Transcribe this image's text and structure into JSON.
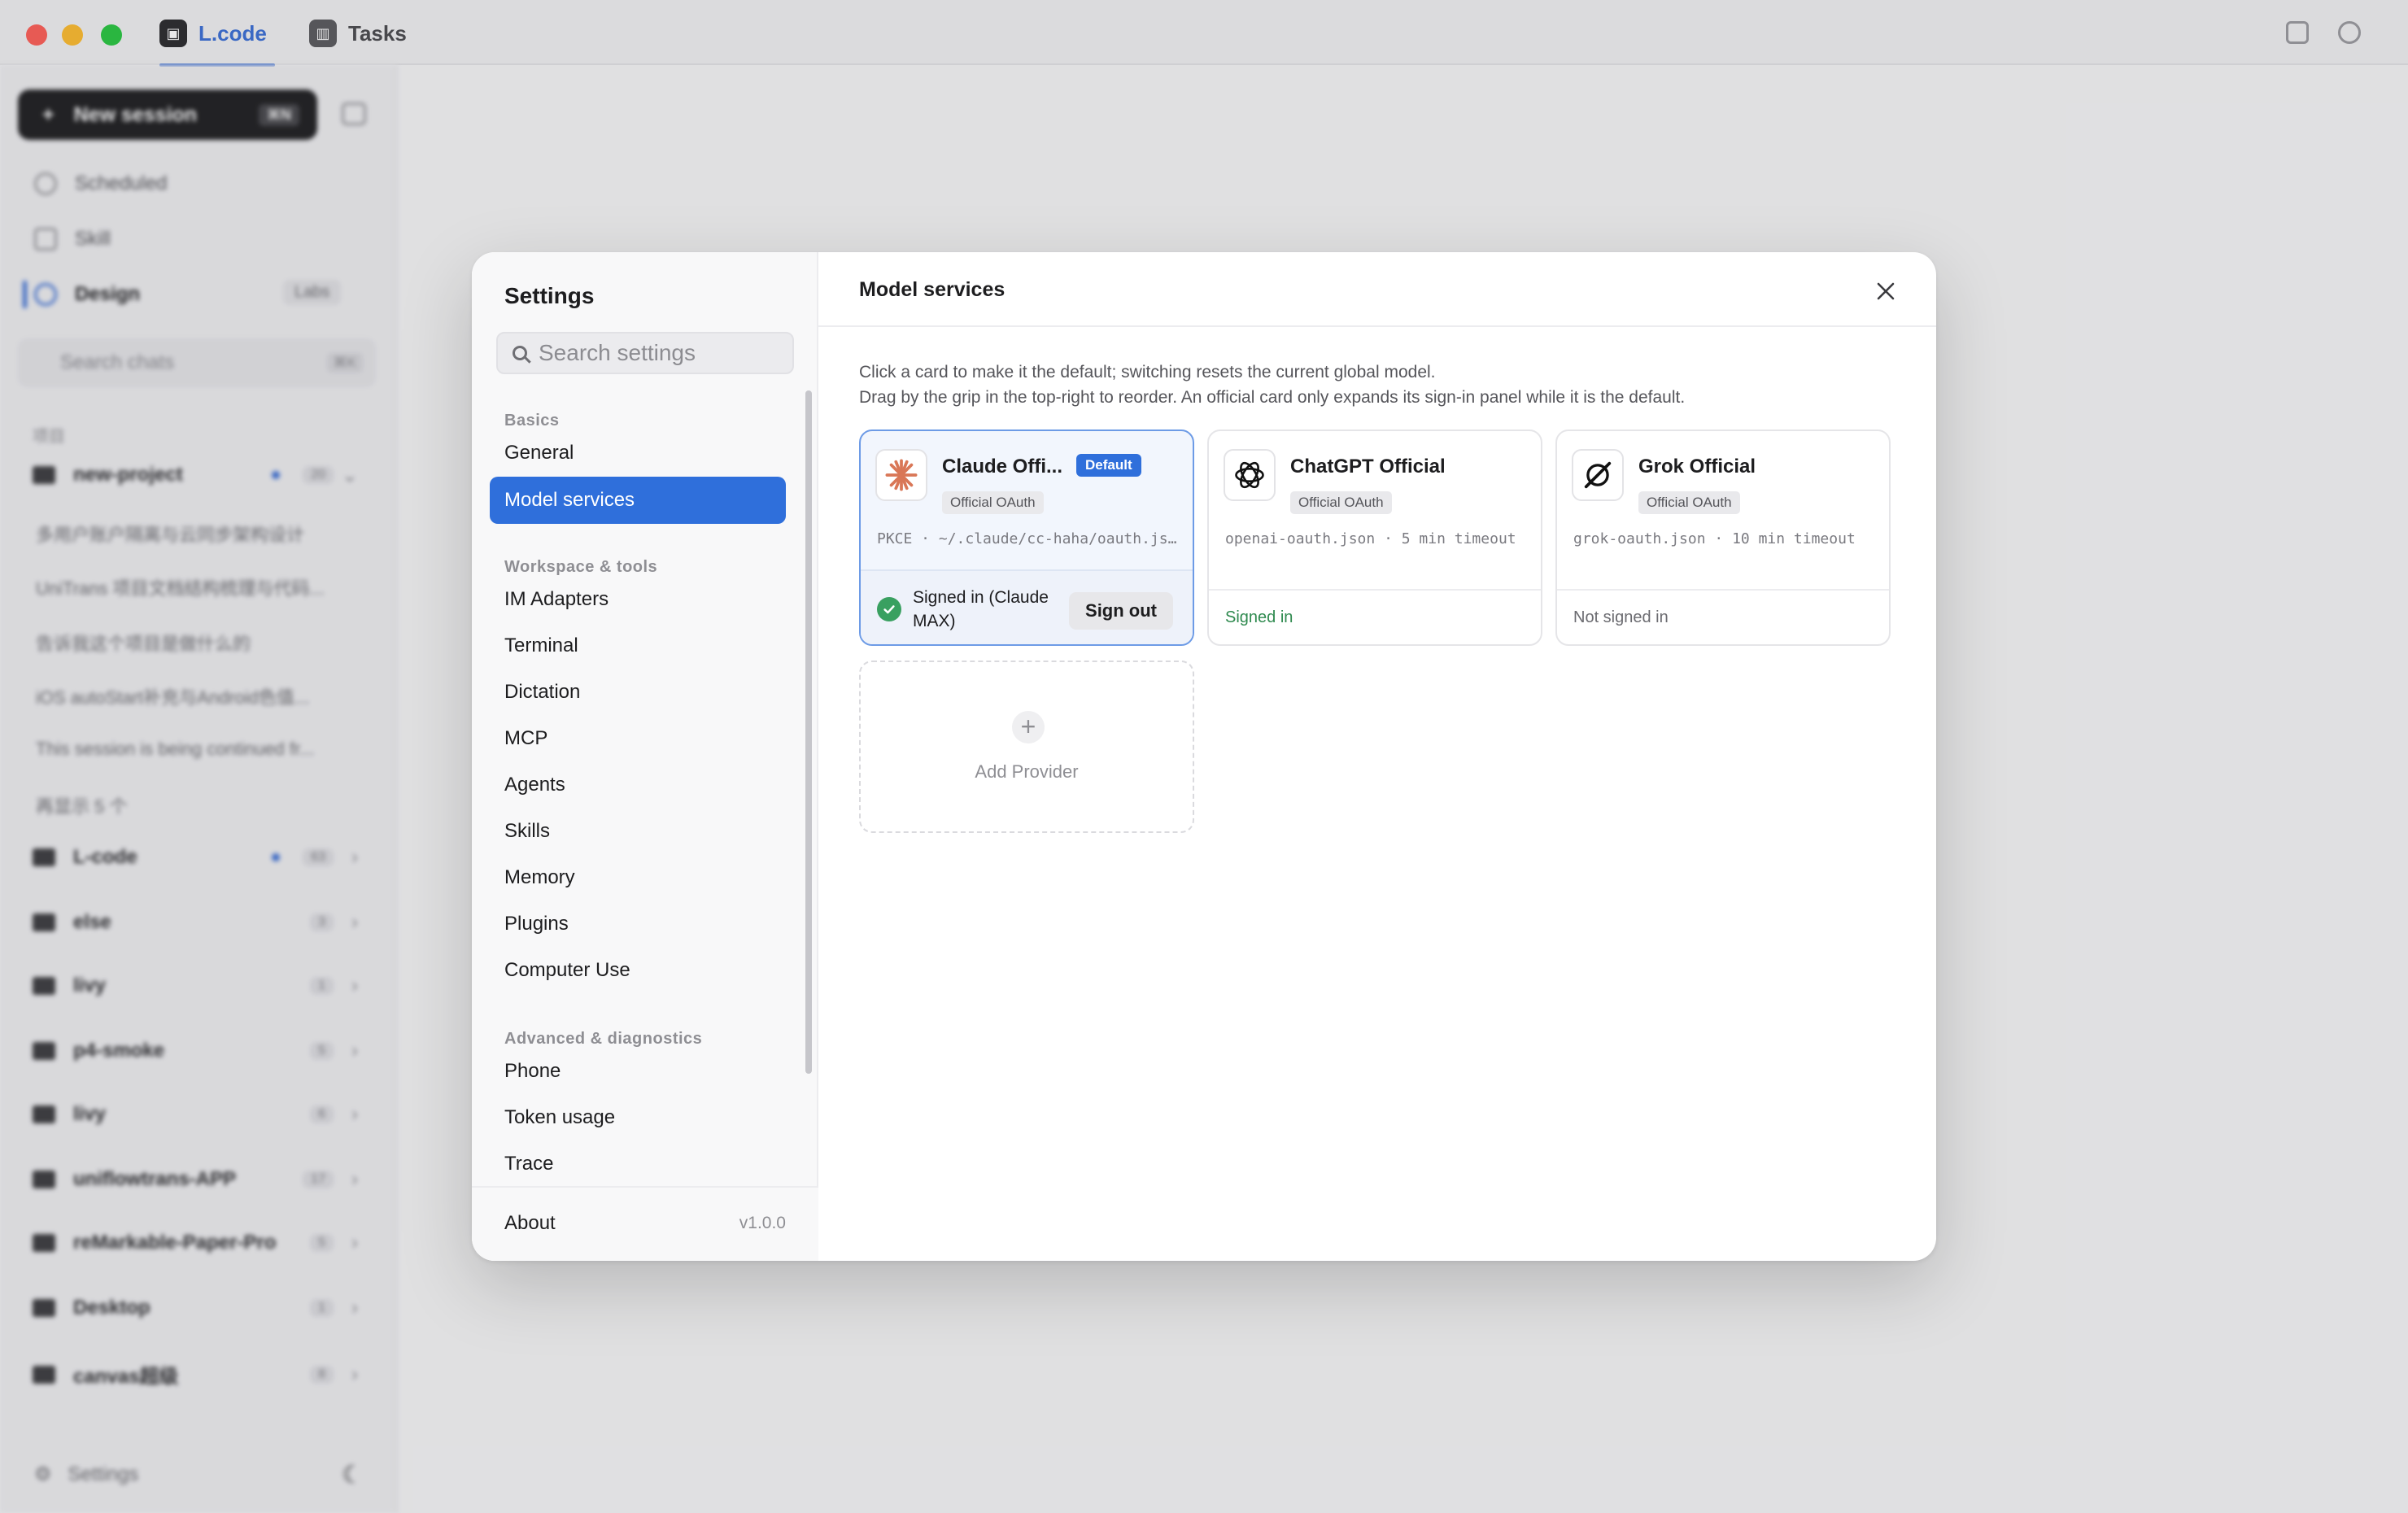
{
  "app": {
    "tabs": [
      {
        "label": "L.code",
        "active": true
      },
      {
        "label": "Tasks",
        "active": false
      }
    ]
  },
  "sidebar": {
    "new_session_label": "New session",
    "new_session_shortcut": "⌘N",
    "nav": [
      {
        "label": "Scheduled",
        "icon": "clock-icon"
      },
      {
        "label": "Skill",
        "icon": "briefcase-icon"
      },
      {
        "label": "Design",
        "icon": "design-icon",
        "badge": "Labs"
      }
    ],
    "search_placeholder": "Search chats",
    "search_shortcut": "⌘K",
    "section_label": "项目",
    "projects": [
      {
        "name": "new-project",
        "count": "20",
        "dot": true
      },
      {
        "name": "L-code",
        "count": "63",
        "dot": true
      },
      {
        "name": "else",
        "count": "3"
      },
      {
        "name": "livy",
        "count": "1"
      },
      {
        "name": "p4-smoke",
        "count": "5"
      },
      {
        "name": "livy",
        "count": "6"
      },
      {
        "name": "uniflowtrans-APP",
        "count": "17"
      },
      {
        "name": "reMarkable-Paper-Pro",
        "count": "5"
      },
      {
        "name": "Desktop",
        "count": "1"
      },
      {
        "name": "canvas超级",
        "count": "8"
      }
    ],
    "chats": [
      "多用户账户隔离与云同步架构设计",
      "UniTrans 项目文档结构梳理与代码...",
      "告诉我这个项目是做什么的",
      "iOS autoStart补充与Android色值...",
      "This session is being continued fr...",
      "再显示 5 个"
    ],
    "footer_settings": "Settings"
  },
  "settings": {
    "title": "Settings",
    "search_placeholder": "Search settings",
    "groups": [
      {
        "label": "Basics",
        "items": [
          "General",
          "Model services"
        ]
      },
      {
        "label": "Workspace & tools",
        "items": [
          "IM Adapters",
          "Terminal",
          "Dictation",
          "MCP",
          "Agents",
          "Skills",
          "Memory",
          "Plugins",
          "Computer Use"
        ]
      },
      {
        "label": "Advanced & diagnostics",
        "items": [
          "Phone",
          "Token usage",
          "Trace"
        ]
      }
    ],
    "active_item": "Model services",
    "about_label": "About",
    "version": "v1.0.0"
  },
  "model_services": {
    "title": "Model services",
    "description_line1": "Click a card to make it the default; switching resets the current global model.",
    "description_line2": "Drag by the grip in the top-right to reorder. An official card only expands its sign-in panel while it is the default.",
    "providers": [
      {
        "name": "Claude Offi...",
        "badge": "Default",
        "auth": "Official OAuth",
        "detail": "PKCE · ~/.claude/cc-haha/oauth.json",
        "status": "Signed in (Claude MAX)",
        "action": "Sign out",
        "icon": "claude-icon",
        "accent": "#d97757"
      },
      {
        "name": "ChatGPT Official",
        "auth": "Official OAuth",
        "detail": "openai-oauth.json · 5 min timeout",
        "status": "Signed in",
        "icon": "openai-icon"
      },
      {
        "name": "Grok Official",
        "auth": "Official OAuth",
        "detail": "grok-oauth.json · 10 min timeout",
        "status": "Not signed in",
        "icon": "grok-icon"
      }
    ],
    "add_provider_label": "Add Provider"
  },
  "colors": {
    "accent": "#2f6fdb",
    "signed_in_green": "#2f8a4f",
    "claude_orange": "#d97757"
  }
}
